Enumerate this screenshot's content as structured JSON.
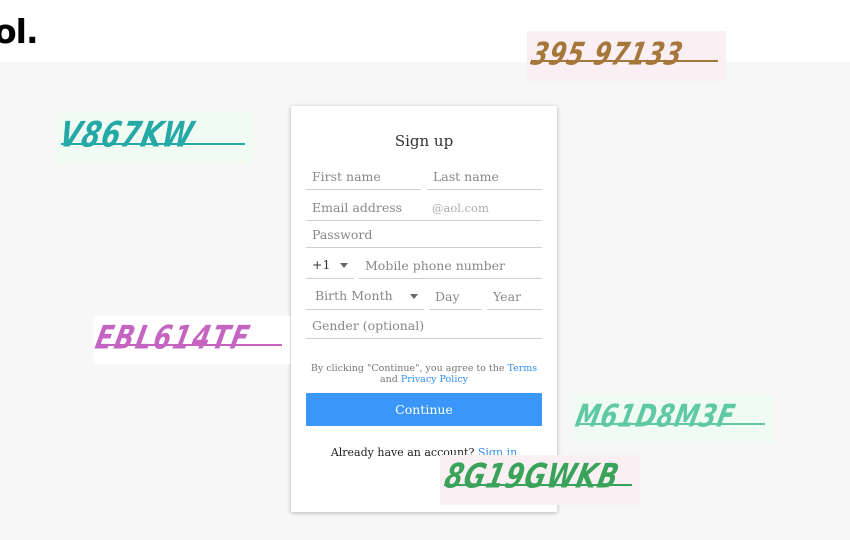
{
  "logo": "ol.",
  "form": {
    "title": "Sign up",
    "first_name_placeholder": "First name",
    "last_name_placeholder": "Last name",
    "email_placeholder": "Email address",
    "email_suffix": "@aol.com",
    "password_placeholder": "Password",
    "country_code": "+1",
    "phone_placeholder": "Mobile phone number",
    "birth_month": "Birth Month",
    "day_placeholder": "Day",
    "year_placeholder": "Year",
    "gender_placeholder": "Gender (optional)",
    "terms_text_1": "By clicking \"Continue\", you agree to the",
    "terms_link": "Terms",
    "terms_and": "and",
    "privacy_link": "Privacy Policy",
    "continue_label": "Continue",
    "already_text": "Already have an account?",
    "sign_in_link": "Sign in"
  },
  "captchas": [
    {
      "text": "395 97133",
      "color": "#a5773a",
      "bg": "#faeff2"
    },
    {
      "text": "V867KW",
      "color": "#25a9a7",
      "bg": "#f0fbf4"
    },
    {
      "text": "EBL614TF",
      "color": "#c664c2",
      "bg": "#ffffff"
    },
    {
      "text": "M61D8M3F",
      "color": "#5fc9a6",
      "bg": "#f0fbf4"
    },
    {
      "text": "8G19GWKB",
      "color": "#3aa35a",
      "bg": "#faeff2"
    }
  ]
}
